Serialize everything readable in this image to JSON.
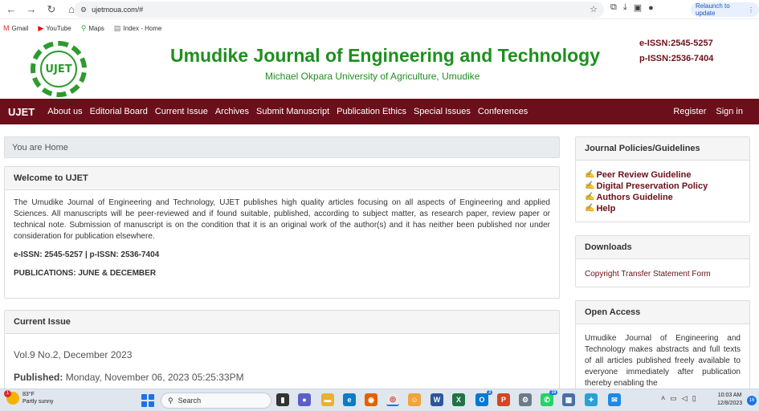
{
  "browser": {
    "url": "ujetmoua.com/#",
    "relaunch": "Relaunch to update",
    "bookmarks": [
      "Gmail",
      "YouTube",
      "Maps",
      "Index - Home"
    ]
  },
  "header": {
    "logo_text": "UJET",
    "title": "Umudike Journal of Engineering and Technology",
    "subtitle": "Michael Okpara University of Agriculture, Umudike",
    "eissn": "e-ISSN:2545-5257",
    "pissn": "p-ISSN:2536-7404"
  },
  "nav": {
    "brand": "UJET",
    "items": [
      "About us",
      "Editorial Board",
      "Current Issue",
      "Archives",
      "Submit Manuscript",
      "Publication Ethics",
      "Special Issues",
      "Conferences"
    ],
    "register": "Register",
    "signin": "Sign in"
  },
  "breadcrumb": "You are Home",
  "welcome": {
    "title": "Welcome to UJET",
    "text": "The Umudike Journal of Engineering and Technology, UJET publishes high quality articles focusing on all aspects of Engineering and applied Sciences. All manuscripts will be peer-reviewed and if found suitable, published, according to subject matter, as research paper, review paper or technical note. Submission of manuscript is on the condition that it is an original work of the author(s) and it has neither been published nor under consideration for publication elsewhere.",
    "issn_line": "e-ISSN: 2545-5257 | p-ISSN: 2536-7404",
    "publications": "PUBLICATIONS: JUNE & DECEMBER"
  },
  "current_issue": {
    "title": "Current Issue",
    "issue": "Vol.9 No.2, December 2023",
    "published_label": "Published:",
    "published_date": "Monday, November 06, 2023 05:25:33PM"
  },
  "policies": {
    "title": "Journal Policies/Guidelines",
    "links": [
      "Peer Review Guideline",
      "Digital Preservation Policy",
      "Authors Guideline",
      "Help"
    ]
  },
  "downloads": {
    "title": "Downloads",
    "link": "Copyright Transfer Statement Form"
  },
  "open_access": {
    "title": "Open Access",
    "text": "Umudike Journal of Engineering and Technology makes abstracts and full texts of all articles published freely available to everyone immediately after publication thereby enabling the"
  },
  "taskbar": {
    "temp": "83°F",
    "weather": "Partly sunny",
    "weather_badge": "1",
    "search": "Search",
    "time": "10:03 AM",
    "date": "12/8/2023",
    "notifications": "16",
    "whatsapp_badge": "19",
    "outlook_badge": "3"
  },
  "colors": {
    "brand_green": "#1e8f1e",
    "brand_maroon": "#6b0f1a"
  }
}
